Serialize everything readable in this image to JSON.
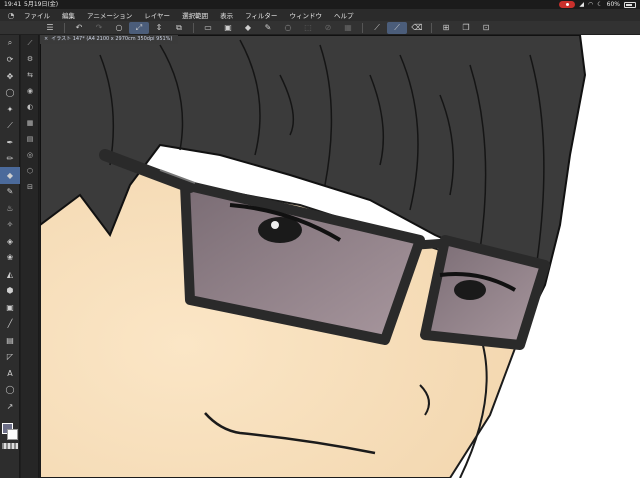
{
  "status": {
    "time": "19:41",
    "date": "5月19日(金)",
    "battery": "60%"
  },
  "menu": [
    "ファイル",
    "編集",
    "アニメーション",
    "レイヤー",
    "選択範囲",
    "表示",
    "フィルター",
    "ウィンドウ",
    "ヘルプ"
  ],
  "document": {
    "tab_close": "×",
    "tab_title": "イラスト 147* (A4 2100 x 2970cm 350dpi 951%)"
  },
  "toolbar_icons": [
    "menu-icon",
    "undo-icon",
    "redo-icon",
    "clear-icon",
    "transform-icon",
    "stepper-icon",
    "copy-icon",
    "paste-icon",
    "save-icon",
    "fill-icon",
    "pen-icon",
    "lasso-icon",
    "select-icon",
    "invert-icon",
    "ruler-icon",
    "pen-tool-icon",
    "brush-icon",
    "eraser-icon",
    "new-layer-icon",
    "layer-icon",
    "canvas-icon"
  ],
  "tools": [
    "zoom-icon",
    "rotate-icon",
    "move-icon",
    "lasso-icon",
    "wand-icon",
    "eyedropper-icon",
    "pen-icon",
    "pencil-icon",
    "brush-icon",
    "airbrush-icon",
    "blend-icon",
    "eraser-icon",
    "fill-icon",
    "decoration-icon",
    "gradient-icon",
    "bucket-icon",
    "frame-icon",
    "line-icon",
    "ruler-icon",
    "text-icon",
    "balloon-icon",
    "correct-icon"
  ],
  "colors": {
    "main": "#6d6f88",
    "sub": "#ffffff",
    "accent": "#4b6a9b"
  }
}
